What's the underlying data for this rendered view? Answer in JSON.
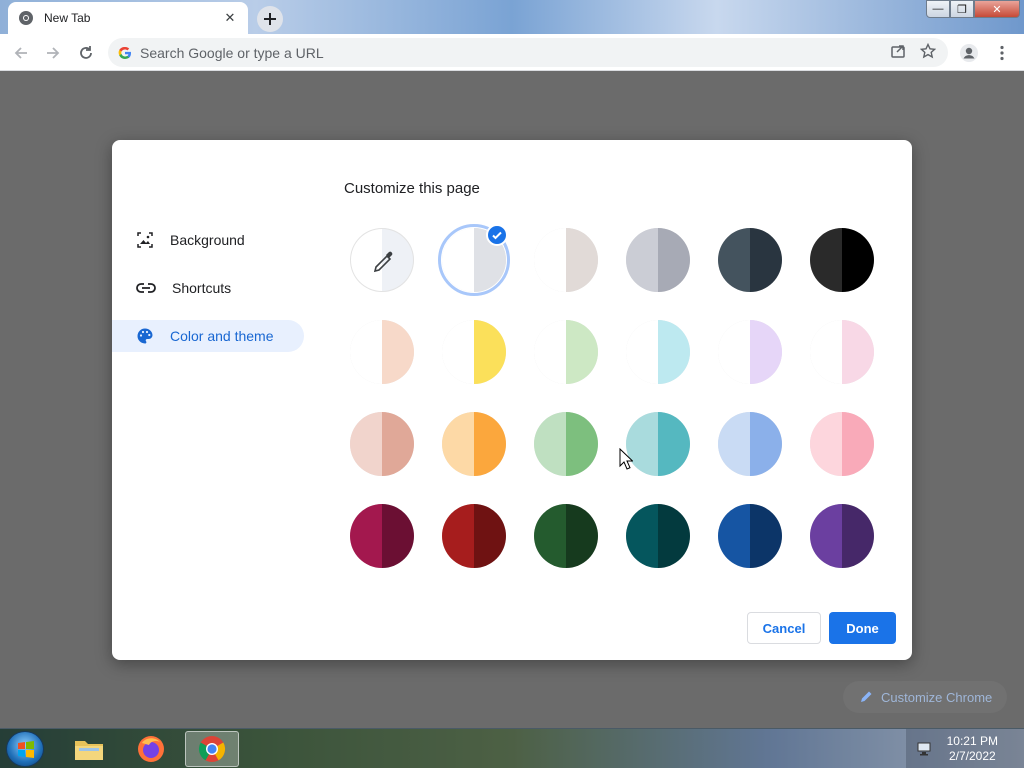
{
  "browser": {
    "tab_title": "New Tab",
    "omnibox_placeholder": "Search Google or type a URL",
    "window_controls": {
      "minimize": "—",
      "restore": "❐",
      "close": "✕"
    }
  },
  "dialog": {
    "title": "Customize this page",
    "menu": [
      {
        "label": "Background",
        "icon": "image-icon"
      },
      {
        "label": "Shortcuts",
        "icon": "link-icon"
      },
      {
        "label": "Color and theme",
        "icon": "palette-icon",
        "selected": true
      }
    ],
    "swatches": [
      [
        "#ffffff",
        "#eef1f6"
      ],
      [
        "#ffffff",
        "#dfe1e6"
      ],
      [
        "#ffffff",
        "#e1dad7"
      ],
      [
        "#cbcdd5",
        "#a7aab5"
      ],
      [
        "#44535e",
        "#293540"
      ],
      [
        "#2a2a2a",
        "#000000"
      ],
      [
        "#ffffff",
        "#f7d9c9"
      ],
      [
        "#ffffff",
        "#fbe05a"
      ],
      [
        "#ffffff",
        "#cde8c4"
      ],
      [
        "#ffffff",
        "#bde9f0"
      ],
      [
        "#ffffff",
        "#e6d6f8"
      ],
      [
        "#ffffff",
        "#f8d8e6"
      ],
      [
        "#f1d4cc",
        "#e0a898"
      ],
      [
        "#fdd9a6",
        "#fba73d"
      ],
      [
        "#bfe0c1",
        "#7dbf7e"
      ],
      [
        "#a9dbdd",
        "#55b8c0"
      ],
      [
        "#c9dbf4",
        "#8bb0ea"
      ],
      [
        "#fdd6dd",
        "#f9aab9"
      ],
      [
        "#a3184e",
        "#6b0f33"
      ],
      [
        "#a61d1d",
        "#6f1212"
      ],
      [
        "#245b2e",
        "#163a1e"
      ],
      [
        "#05565d",
        "#033a3e"
      ],
      [
        "#1655a3",
        "#0c3568"
      ],
      [
        "#6b3fa0",
        "#462869"
      ]
    ],
    "selected_swatch": 1,
    "cancel_label": "Cancel",
    "done_label": "Done"
  },
  "page": {
    "customize_chrome_label": "Customize Chrome"
  },
  "taskbar": {
    "time": "10:21 PM",
    "date": "2/7/2022"
  },
  "colors": {
    "accent": "#1a73e8",
    "selected_menu_bg": "#e8f0fe"
  }
}
